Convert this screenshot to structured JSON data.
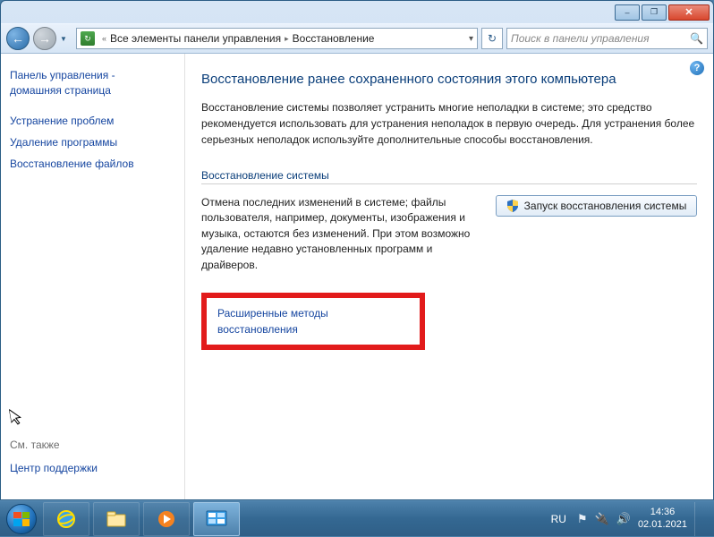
{
  "titlebar": {
    "min": "–",
    "max": "❐",
    "close": "✕"
  },
  "nav": {
    "breadcrumb_root": "Все элементы панели управления",
    "breadcrumb_current": "Восстановление",
    "search_placeholder": "Поиск в панели управления"
  },
  "sidebar": {
    "home_line1": "Панель управления -",
    "home_line2": "домашняя страница",
    "links": [
      "Устранение проблем",
      "Удаление программы",
      "Восстановление файлов"
    ],
    "see_also": "См. также",
    "support": "Центр поддержки"
  },
  "main": {
    "heading": "Восстановление ранее сохраненного состояния этого компьютера",
    "description": "Восстановление системы позволяет устранить многие неполадки в системе; это средство рекомендуется использовать для устранения неполадок в первую очередь. Для устранения более серьезных неполадок используйте дополнительные способы восстановления.",
    "section_title": "Восстановление системы",
    "section_desc": "Отмена последних изменений в системе; файлы пользователя, например, документы, изображения и музыка, остаются без изменений. При этом возможно удаление недавно установленных программ и драйверов.",
    "action_button": "Запуск восстановления системы",
    "advanced_link": "Расширенные методы восстановления"
  },
  "taskbar": {
    "lang": "RU",
    "time": "14:36",
    "date": "02.01.2021"
  }
}
